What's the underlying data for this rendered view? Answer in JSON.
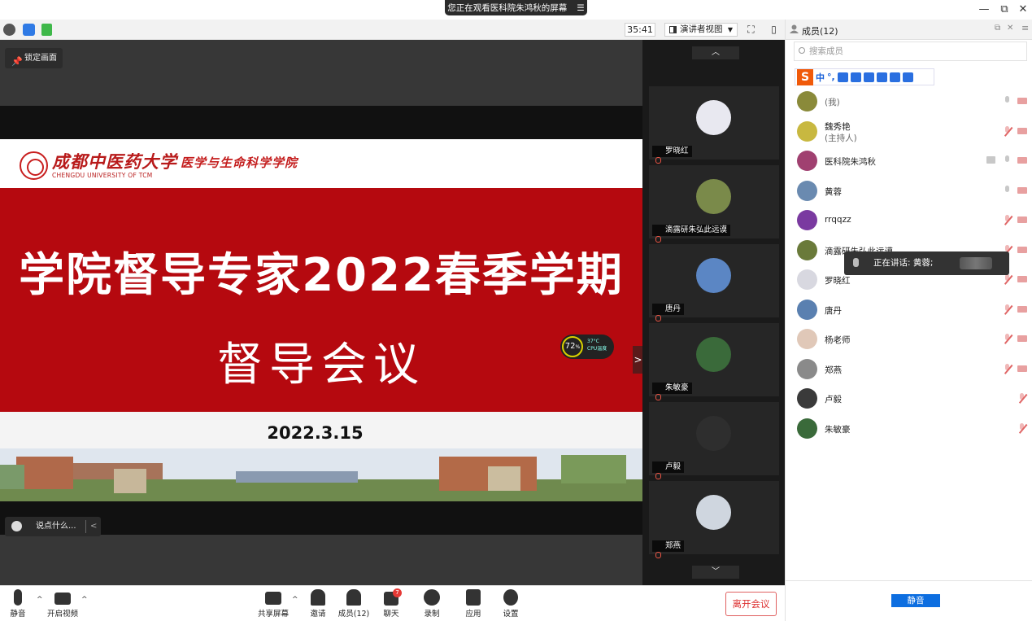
{
  "titlebar": {
    "share_notice": "您正在观看医科院朱鸿秋的屏幕",
    "menu_glyph": "☰",
    "minimize": "—",
    "restore": "⧉",
    "close": "✕"
  },
  "meeting_bar": {
    "timer": "35:41",
    "view_mode": "演讲者视图",
    "icons": [
      "info-icon",
      "shield-icon",
      "signal-icon",
      "fullscreen-icon",
      "layout-icon"
    ]
  },
  "stage": {
    "lock_label": "锁定画面",
    "chat_placeholder": "说点什么...",
    "chat_collapse": "<",
    "collapse_tab": ">"
  },
  "slide": {
    "university_cn": "成都中医药大学",
    "university_en": "CHENGDU UNIVERSITY OF TCM",
    "college": "医学与生命科学学院",
    "title_line1": "学院督导专家2022春季学期",
    "title_line2": "督导会议",
    "date": "2022.3.15"
  },
  "cpu_widget": {
    "percent": "72",
    "percent_unit": "%",
    "temperature": "37°C",
    "label": "CPU温度"
  },
  "gallery": {
    "up": "︿",
    "down": "﹀",
    "tiles": [
      {
        "name": "罗晓红",
        "color": "#e8e8f0"
      },
      {
        "name": "滴露研朱弘此远谟",
        "color": "#7a8a4a"
      },
      {
        "name": "唐丹",
        "color": "#5b86c4"
      },
      {
        "name": "朱敏豪",
        "color": "#3a6a3a"
      },
      {
        "name": "卢毅",
        "color": "#2e2e2e"
      },
      {
        "name": "郑燕",
        "color": "#cfd6df"
      }
    ]
  },
  "panel": {
    "title": "成员(12)",
    "search_placeholder": "搜索成员",
    "ime": {
      "logo": "S",
      "mode": "中",
      "punct": "°,"
    },
    "members": [
      {
        "name": "",
        "role": "(我)",
        "color": "#8a8a3a",
        "mic": "on",
        "cam": "off"
      },
      {
        "name": "魏秀艳",
        "role": "(主持人)",
        "color": "#c8b840",
        "mic": "off",
        "cam": "off"
      },
      {
        "name": "医科院朱鸿秋",
        "role": "",
        "color": "#a04070",
        "mic": "on",
        "cam": "off",
        "sharing": true
      },
      {
        "name": "黄蓉",
        "role": "",
        "color": "#6a8ab0",
        "mic": "on",
        "cam": "off"
      },
      {
        "name": "rrqqzz",
        "role": "",
        "color": "#7a3aa0",
        "mic": "off",
        "cam": "off"
      },
      {
        "name": "滴露研朱弘此远谟",
        "role": "",
        "color": "#6a7a3a",
        "mic": "off",
        "cam": "off"
      },
      {
        "name": "罗晓红",
        "role": "",
        "color": "#d8d8e0",
        "mic": "off",
        "cam": "off"
      },
      {
        "name": "唐丹",
        "role": "",
        "color": "#5a80b0",
        "mic": "off",
        "cam": "off"
      },
      {
        "name": "杨老师",
        "role": "",
        "color": "#e0c8b8",
        "mic": "off",
        "cam": "off"
      },
      {
        "name": "郑燕",
        "role": "",
        "color": "#8a8a8a",
        "mic": "off",
        "cam": "off"
      },
      {
        "name": "卢毅",
        "role": "",
        "color": "#3a3a3a",
        "mic": "off",
        "cam": "none"
      },
      {
        "name": "朱敏豪",
        "role": "",
        "color": "#3a6a3a",
        "mic": "off",
        "cam": "none"
      }
    ],
    "speaking_label": "正在讲话: 黄蓉;",
    "mute_all": "静音"
  },
  "toolbar": {
    "mute": "静音",
    "video": "开启视频",
    "share": "共享屏幕",
    "invite": "邀请",
    "members": "成员(12)",
    "chat": "聊天",
    "chat_badge": "7",
    "record": "录制",
    "apps": "应用",
    "settings": "设置",
    "leave": "离开会议",
    "caret": "^"
  },
  "colors": {
    "slide_red": "#b5090f",
    "accent_blue": "#0d6ee0",
    "leave_red": "#d33333"
  }
}
